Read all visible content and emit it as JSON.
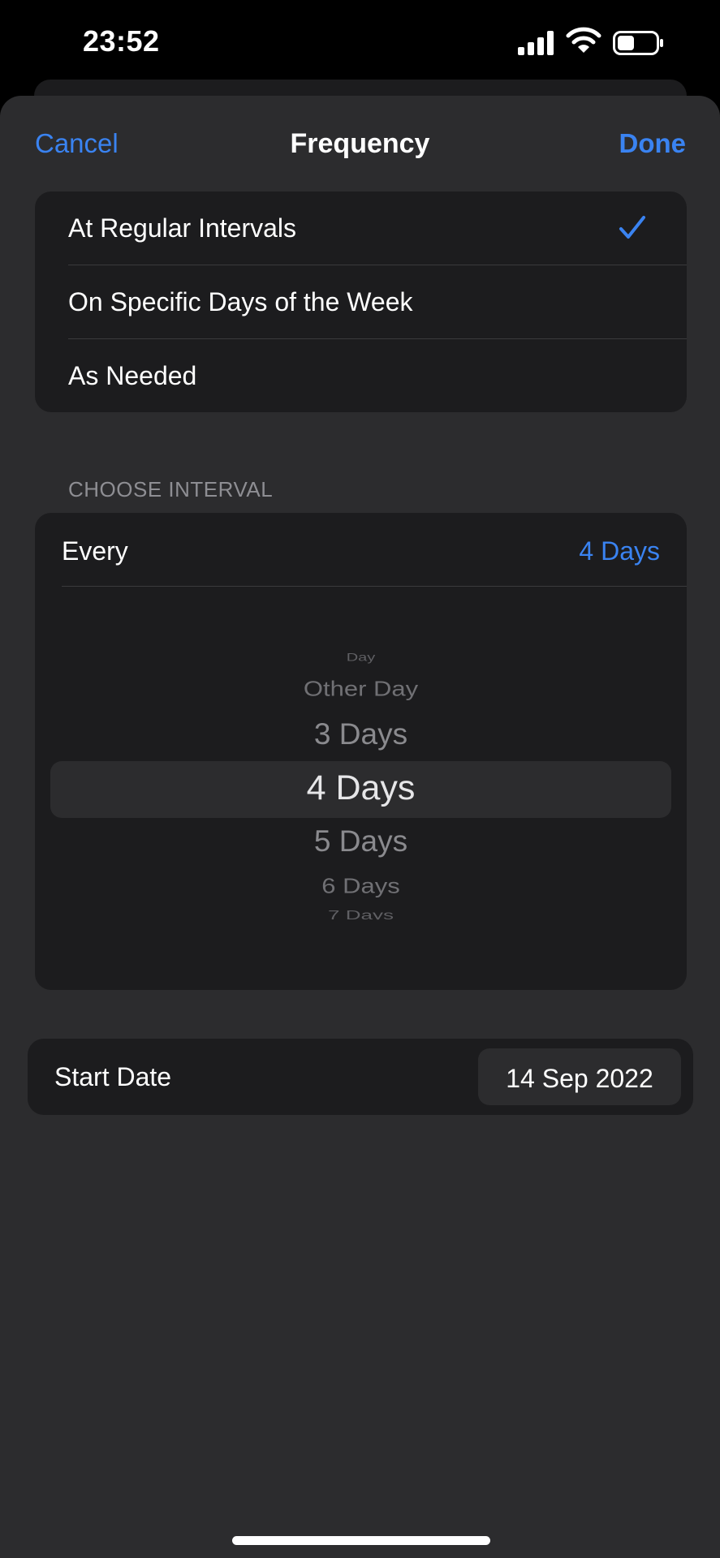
{
  "status": {
    "time": "23:52",
    "icons": [
      "signal-icon",
      "wifi-icon",
      "battery-icon"
    ]
  },
  "nav": {
    "cancel": "Cancel",
    "title": "Frequency",
    "done": "Done"
  },
  "frequency_options": [
    {
      "label": "At Regular Intervals",
      "selected": true
    },
    {
      "label": "On Specific Days of the Week",
      "selected": false
    },
    {
      "label": "As Needed",
      "selected": false
    }
  ],
  "interval": {
    "section_header": "CHOOSE INTERVAL",
    "every_label": "Every",
    "every_value": "4 Days",
    "picker_items": [
      "Day",
      "Other Day",
      "3 Days",
      "4 Days",
      "5 Days",
      "6 Days",
      "7 Days"
    ],
    "selected_item": "4 Days"
  },
  "start_date": {
    "label": "Start Date",
    "value": "14 Sep 2022"
  },
  "colors": {
    "accent": "#3a83f1",
    "background": "#000000",
    "sheet": "#2c2c2e",
    "card": "#1c1c1e",
    "secondary_text": "#8e8e93"
  }
}
